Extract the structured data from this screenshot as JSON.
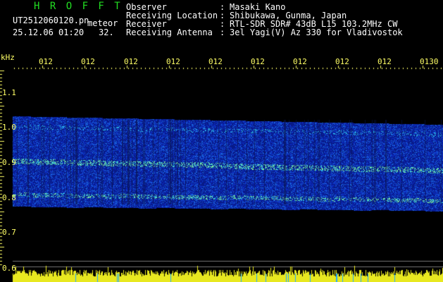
{
  "header": {
    "brand": "H R O F F T",
    "filename": "UT2512060120.pn",
    "detection": "meteor",
    "datetime": "25.12.06 01:20",
    "count": "32.",
    "fields": [
      {
        "label": "Observer",
        "value": "Masaki Kano"
      },
      {
        "label": "Receiving Location",
        "value": "Shibukawa, Gunma, Japan"
      },
      {
        "label": "Receiver",
        "value": "RTL-SDR SDR# 43dB L15 103.2MHz CW"
      },
      {
        "label": "Receiving Antenna",
        "value": "3el Yagi(V) Az 330 for Vladivostok"
      }
    ]
  },
  "axes": {
    "y_unit": "kHz",
    "y_labels": [
      "1.1",
      "1.0",
      "0.9",
      "0.8",
      "0.7",
      "0.6"
    ],
    "x_labels": [
      "012",
      "012",
      "012",
      "012",
      "012",
      "012",
      "012",
      "012",
      "012",
      "0130"
    ]
  },
  "colors": {
    "text_green": "#22dd22",
    "text_white": "#ffffff",
    "axis_yellow": "#ffff66",
    "spectrum_base": "#0a1a9a"
  }
}
